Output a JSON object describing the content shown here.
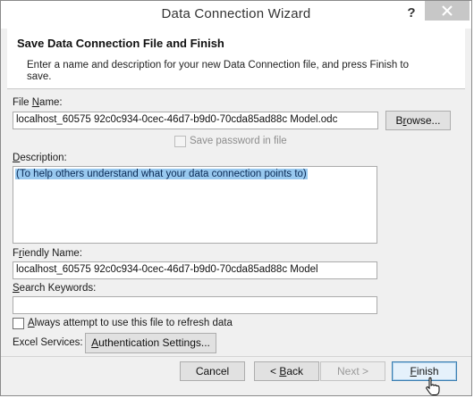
{
  "window": {
    "title": "Data Connection Wizard",
    "help_label": "?"
  },
  "header": {
    "title": "Save Data Connection File and Finish",
    "description": "Enter a name and description for your new Data Connection file, and press Finish to save."
  },
  "file_name": {
    "label_prefix": "File ",
    "label_accel": "N",
    "label_suffix": "ame:",
    "value": "localhost_60575 92c0c934-0cec-46d7-b9d0-70cda85ad88c Model.odc",
    "browse_label_prefix": "B",
    "browse_label_accel": "r",
    "browse_label_suffix": "owse..."
  },
  "save_password": {
    "label": "Save password in file",
    "checked": false,
    "enabled": false
  },
  "description": {
    "label_accel": "D",
    "label_suffix": "escription:",
    "value": "(To help others understand what your data connection points to)"
  },
  "friendly_name": {
    "label_prefix": "F",
    "label_accel": "r",
    "label_suffix": "iendly Name:",
    "value": "localhost_60575 92c0c934-0cec-46d7-b9d0-70cda85ad88c Model"
  },
  "search_keywords": {
    "label_accel": "S",
    "label_suffix": "earch Keywords:",
    "value": ""
  },
  "always_refresh": {
    "label_accel": "A",
    "label_suffix": "lways attempt to use this file to refresh data",
    "checked": false
  },
  "excel_services": {
    "label": "Excel Services:",
    "button_accel": "A",
    "button_suffix": "uthentication Settings..."
  },
  "footer": {
    "cancel_label": "Cancel",
    "back_prefix": "< ",
    "back_accel": "B",
    "back_suffix": "ack",
    "next_label": "Next >",
    "finish_accel": "F",
    "finish_suffix": "inish"
  },
  "colors": {
    "selection": "#99c9ef",
    "default_button_border": "#3c7fb1",
    "close_button": "#c7c7c7"
  }
}
